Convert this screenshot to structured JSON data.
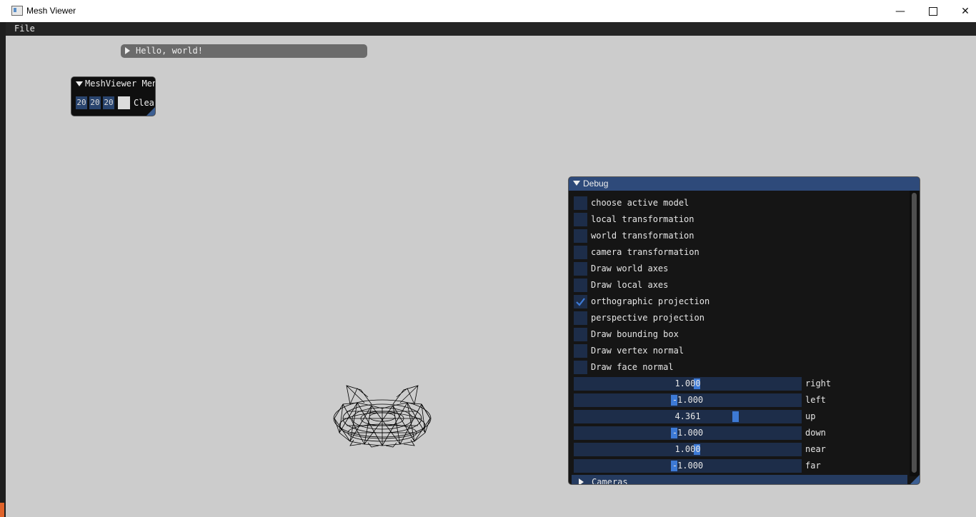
{
  "window": {
    "title": "Mesh Viewer"
  },
  "menubar": {
    "file_label": "File"
  },
  "hello_window": {
    "title": "Hello, world!"
  },
  "meshviewer_window": {
    "title": "MeshViewer Menu",
    "color_values": [
      "20",
      "20",
      "20"
    ],
    "clear_label": "Clear"
  },
  "debug_window": {
    "title": "Debug",
    "checkboxes": [
      {
        "label": "choose active model",
        "checked": false
      },
      {
        "label": "local transformation",
        "checked": false
      },
      {
        "label": "world transformation",
        "checked": false
      },
      {
        "label": "camera transformation",
        "checked": false
      },
      {
        "label": "Draw world axes",
        "checked": false
      },
      {
        "label": "Draw local axes",
        "checked": false
      },
      {
        "label": "orthographic projection",
        "checked": true
      },
      {
        "label": "perspective projection",
        "checked": false
      },
      {
        "label": "Draw bounding box",
        "checked": false
      },
      {
        "label": "Draw vertex normal",
        "checked": false
      },
      {
        "label": "Draw face normal",
        "checked": false
      }
    ],
    "sliders": [
      {
        "label": "right",
        "value": "1.000",
        "fill": 0.54
      },
      {
        "label": "left",
        "value": "-1.000",
        "fill": 0.44
      },
      {
        "label": "up",
        "value": "4.361",
        "fill": 0.71
      },
      {
        "label": "down",
        "value": "-1.000",
        "fill": 0.44
      },
      {
        "label": "near",
        "value": "1.000",
        "fill": 0.54
      },
      {
        "label": "far",
        "value": "-1.000",
        "fill": 0.44
      }
    ],
    "cameras_label": "Cameras"
  },
  "colors": {
    "accent": "#3d7ad6",
    "frame": "#1d2d49",
    "title_active": "#2e4a7a"
  }
}
